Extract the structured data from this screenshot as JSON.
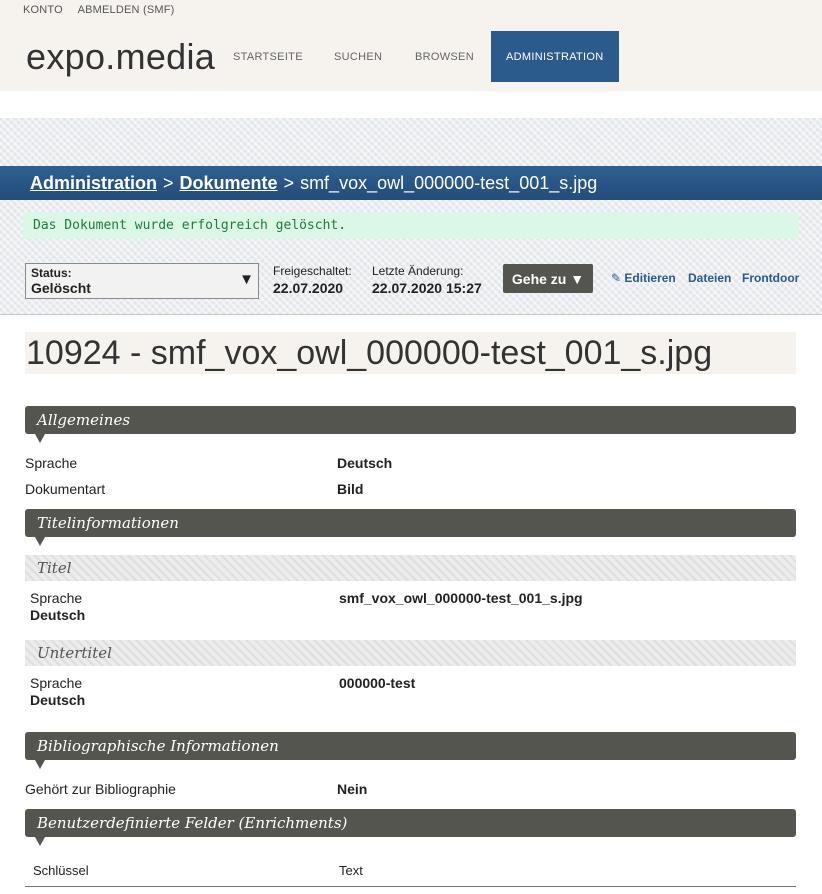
{
  "account_links": [
    "KONTO",
    "ABMELDEN (SMF)"
  ],
  "brand": "expo.media",
  "nav": [
    {
      "label": "STARTSEITE",
      "active": false
    },
    {
      "label": "SUCHEN",
      "active": false
    },
    {
      "label": "BROWSEN",
      "active": false
    },
    {
      "label": "ADMINISTRATION",
      "active": true
    }
  ],
  "breadcrumb": {
    "crumbs": [
      "Administration",
      "Dokumente"
    ],
    "separator": ">",
    "current": "smf_vox_owl_000000-test_001_s.jpg"
  },
  "flash_message": "Das Dokument wurde erfolgreich gelöscht.",
  "status_select": {
    "label": "Status:",
    "value": "Gelöscht",
    "arrow_icon": "triangle-down-icon"
  },
  "published": {
    "label": "Freigeschaltet:",
    "value": "22.07.2020"
  },
  "last_change": {
    "label": "Letzte Änderung:",
    "value": "22.07.2020 15:27"
  },
  "goto_button": "Gehe zu ▼",
  "actions": {
    "edit": "Editieren",
    "edit_icon": "pencil-icon",
    "files": "Dateien",
    "frontdoor": "Frontdoor"
  },
  "document_title": "10924 - smf_vox_owl_000000-test_001_s.jpg",
  "sections": {
    "general": {
      "heading": "Allgemeines",
      "rows": [
        {
          "label": "Sprache",
          "value": "Deutsch"
        },
        {
          "label": "Dokumentart",
          "value": "Bild"
        }
      ]
    },
    "titles": {
      "heading": "Titelinformationen",
      "title": {
        "heading": "Titel",
        "lang_label": "Sprache",
        "lang_value": "Deutsch",
        "value": "smf_vox_owl_000000-test_001_s.jpg"
      },
      "subtitle": {
        "heading": "Untertitel",
        "lang_label": "Sprache",
        "lang_value": "Deutsch",
        "value": "000000-test"
      }
    },
    "bibliographic": {
      "heading": "Bibliographische Informationen",
      "rows": [
        {
          "label": "Gehört zur Bibliographie",
          "value": "Nein"
        }
      ]
    },
    "enrichments": {
      "heading": "Benutzerdefinierte Felder (Enrichments)",
      "columns": [
        "Schlüssel",
        "Text"
      ]
    }
  },
  "colors": {
    "nav_active": "#2b5a8c",
    "section_head": "#555550",
    "flash_bg": "#dbf7e6",
    "flash_text": "#217a3e"
  }
}
